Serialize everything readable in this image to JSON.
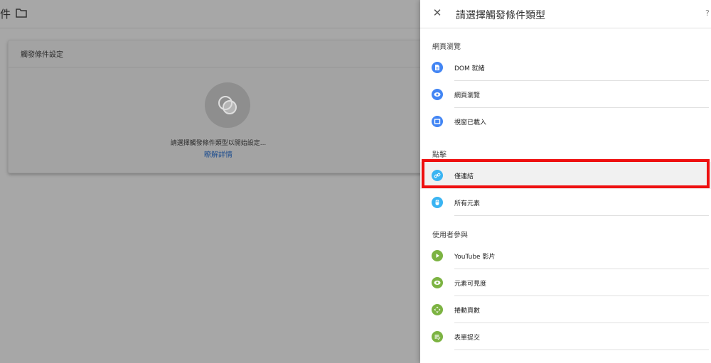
{
  "background": {
    "title_fragment": "件",
    "card_title": "觸發條件設定",
    "card_message": "請選擇觸發條件類型以開始設定...",
    "card_link": "瞭解詳情"
  },
  "panel": {
    "title": "請選擇觸發條件類型",
    "help_glyph": "?",
    "close_glyph": "✕"
  },
  "sections": [
    {
      "title": "網頁瀏覽",
      "items": [
        {
          "label": "DOM 就緒",
          "icon": "document-icon",
          "color": "#4285f4"
        },
        {
          "label": "網頁瀏覽",
          "icon": "eye-icon",
          "color": "#4285f4"
        },
        {
          "label": "視窗已載入",
          "icon": "window-icon",
          "color": "#4285f4"
        }
      ]
    },
    {
      "title": "點擊",
      "items": [
        {
          "label": "僅連結",
          "icon": "link-icon",
          "color": "#3ab4f2",
          "selected": true
        },
        {
          "label": "所有元素",
          "icon": "cursor-icon",
          "color": "#3ab4f2"
        }
      ]
    },
    {
      "title": "使用者參與",
      "items": [
        {
          "label": "YouTube 影片",
          "icon": "play-icon",
          "color": "#7cb342"
        },
        {
          "label": "元素可見度",
          "icon": "eye-icon",
          "color": "#7cb342"
        },
        {
          "label": "捲動頁數",
          "icon": "scroll-icon",
          "color": "#7cb342"
        },
        {
          "label": "表單提交",
          "icon": "form-icon",
          "color": "#7cb342"
        }
      ]
    }
  ]
}
